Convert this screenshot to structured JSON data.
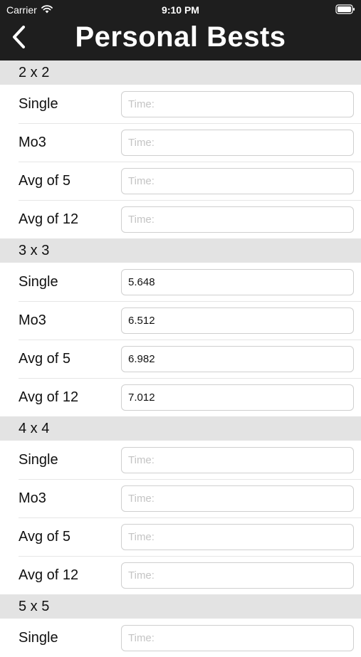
{
  "status_bar": {
    "carrier": "Carrier",
    "time": "9:10 PM",
    "wifi_icon": "wifi-icon",
    "battery_icon": "battery-icon"
  },
  "nav": {
    "back_icon": "chevron-left-icon",
    "title": "Personal Bests"
  },
  "placeholder": "Time:",
  "sections": [
    {
      "title": "2 x 2",
      "rows": [
        {
          "label": "Single",
          "value": ""
        },
        {
          "label": "Mo3",
          "value": ""
        },
        {
          "label": "Avg of 5",
          "value": ""
        },
        {
          "label": "Avg of 12",
          "value": ""
        }
      ]
    },
    {
      "title": "3 x 3",
      "rows": [
        {
          "label": "Single",
          "value": "5.648"
        },
        {
          "label": "Mo3",
          "value": "6.512"
        },
        {
          "label": "Avg of 5",
          "value": "6.982"
        },
        {
          "label": "Avg of 12",
          "value": "7.012"
        }
      ]
    },
    {
      "title": "4 x 4",
      "rows": [
        {
          "label": "Single",
          "value": ""
        },
        {
          "label": "Mo3",
          "value": ""
        },
        {
          "label": "Avg of 5",
          "value": ""
        },
        {
          "label": "Avg of 12",
          "value": ""
        }
      ]
    },
    {
      "title": "5 x 5",
      "rows": [
        {
          "label": "Single",
          "value": ""
        }
      ]
    }
  ]
}
